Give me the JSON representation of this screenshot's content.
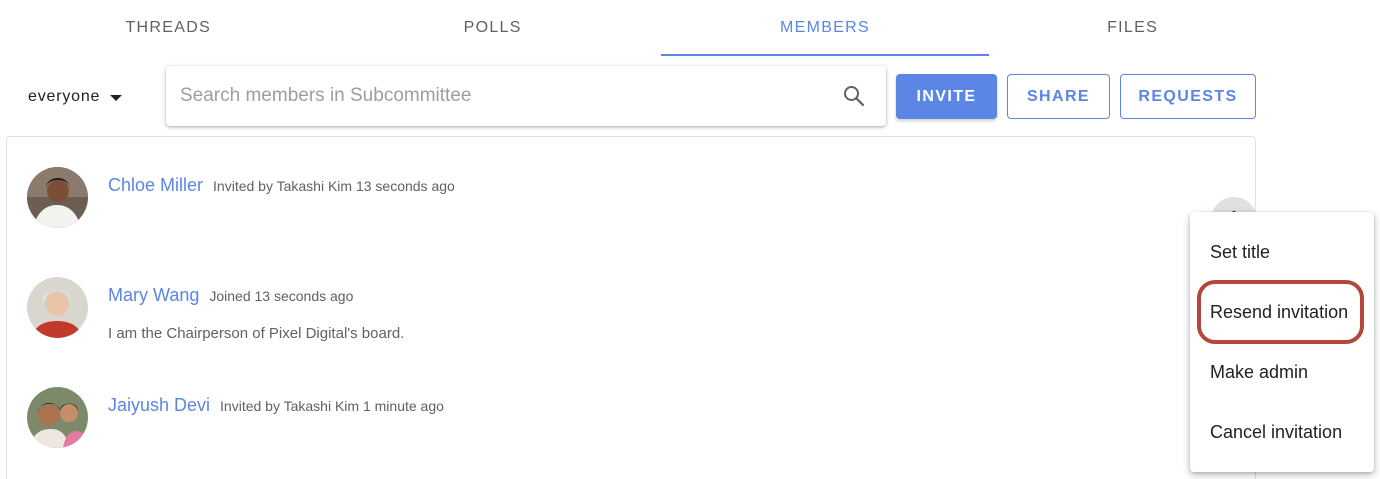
{
  "tabs": [
    {
      "label": "THREADS"
    },
    {
      "label": "POLLS"
    },
    {
      "label": "MEMBERS",
      "active": true
    },
    {
      "label": "FILES"
    }
  ],
  "toolbar": {
    "filter_label": "everyone",
    "search_placeholder": "Search members in Subcommittee",
    "invite_label": "INVITE",
    "share_label": "SHARE",
    "requests_label": "REQUESTS"
  },
  "members": [
    {
      "name": "Chloe Miller",
      "meta": "Invited by Takashi Kim 13 seconds ago",
      "bio": ""
    },
    {
      "name": "Mary Wang",
      "meta": "Joined 13 seconds ago",
      "bio": "I am the Chairperson of Pixel Digital's board."
    },
    {
      "name": "Jaiyush Devi",
      "meta": "Invited by Takashi Kim 1 minute ago",
      "bio": ""
    }
  ],
  "menu": {
    "items": [
      {
        "label": "Set title"
      },
      {
        "label": "Resend invitation"
      },
      {
        "label": "Make admin"
      },
      {
        "label": "Cancel invitation"
      }
    ],
    "highlighted_item": "Resend invitation"
  },
  "colors": {
    "accent": "#5b86e5",
    "highlight_ring": "#b5463c",
    "text_secondary": "#616161"
  },
  "icons": {
    "search": "search-icon",
    "more": "more-vertical-icon",
    "filter_caret": "caret-down-icon"
  }
}
